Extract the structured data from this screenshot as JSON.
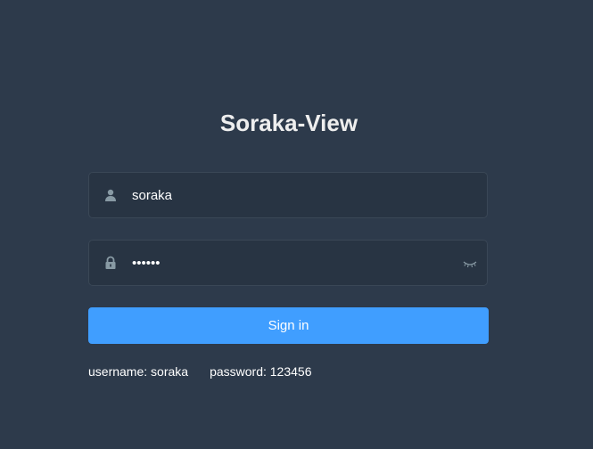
{
  "login": {
    "title": "Soraka-View",
    "username": {
      "icon": "user-icon",
      "value": "soraka"
    },
    "password": {
      "icon": "lock-icon",
      "value": "123456",
      "masked_display": "••••••",
      "toggle_icon": "eye-closed-icon"
    },
    "signin_label": "Sign in",
    "tips": {
      "username": "username: soraka",
      "password": "password: 123456"
    }
  },
  "colors": {
    "background": "#2d3a4b",
    "field_background": "#283443",
    "accent": "#409eff",
    "icon": "#889aa4"
  }
}
